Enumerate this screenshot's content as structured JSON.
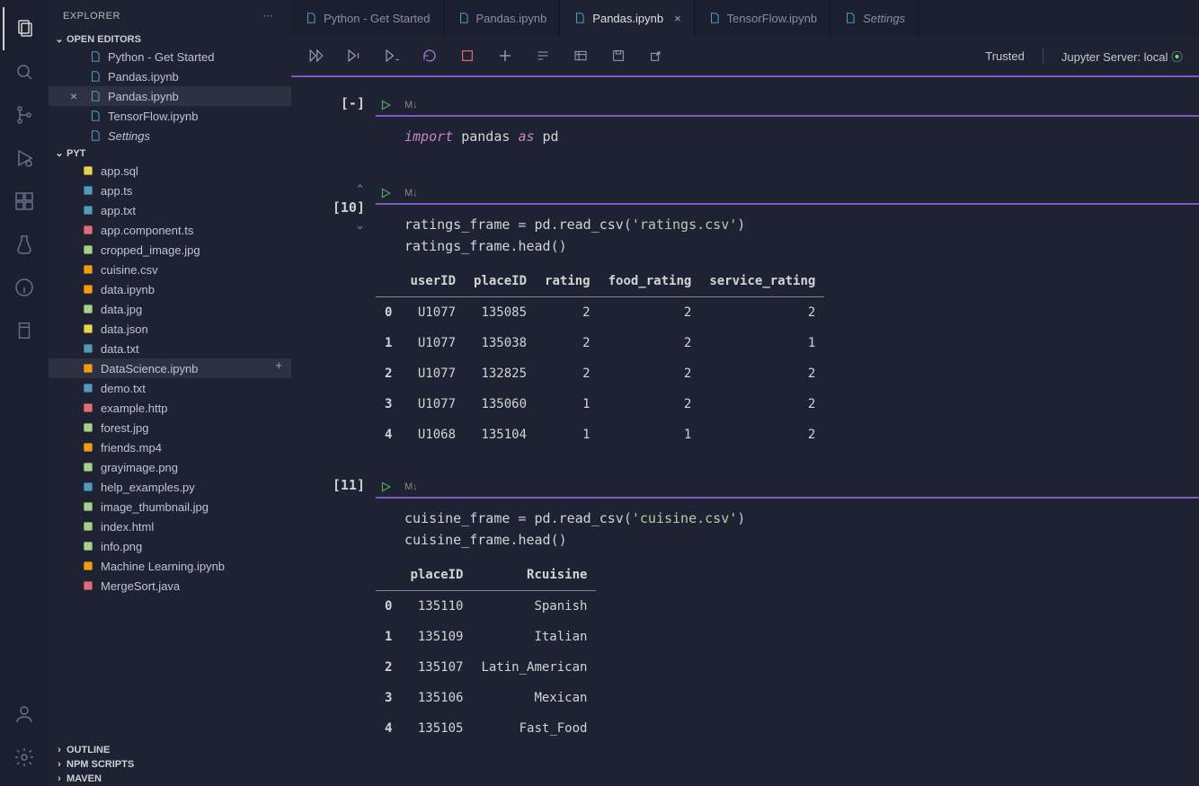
{
  "sidebar": {
    "title": "EXPLORER",
    "sections": {
      "open_editors": {
        "label": "OPEN EDITORS",
        "items": [
          {
            "name": "Python - Get Started",
            "icon": "file-blue"
          },
          {
            "name": "Pandas.ipynb",
            "icon": "file-blue"
          },
          {
            "name": "Pandas.ipynb",
            "icon": "file-blue",
            "active": true,
            "closable": true
          },
          {
            "name": "TensorFlow.ipynb",
            "icon": "file-blue"
          },
          {
            "name": "Settings",
            "icon": "file-blue",
            "italic": true
          }
        ]
      },
      "folder": {
        "label": "PYT",
        "items": [
          {
            "name": "app.sql",
            "color": "#e8d44d"
          },
          {
            "name": "app.ts",
            "color": "#519aba"
          },
          {
            "name": "app.txt",
            "color": "#519aba"
          },
          {
            "name": "app.component.ts",
            "color": "#e06c75"
          },
          {
            "name": "cropped_image.jpg",
            "color": "#a6d189"
          },
          {
            "name": "cuisine.csv",
            "color": "#f39c12"
          },
          {
            "name": "data.ipynb",
            "color": "#f39c12"
          },
          {
            "name": "data.jpg",
            "color": "#a6d189"
          },
          {
            "name": "data.json",
            "color": "#e8d44d"
          },
          {
            "name": "data.txt",
            "color": "#519aba"
          },
          {
            "name": "DataScience.ipynb",
            "color": "#f39c12",
            "active": true
          },
          {
            "name": "demo.txt",
            "color": "#519aba"
          },
          {
            "name": "example.http",
            "color": "#e06c75"
          },
          {
            "name": "forest.jpg",
            "color": "#a6d189"
          },
          {
            "name": "friends.mp4",
            "color": "#f39c12"
          },
          {
            "name": "grayimage.png",
            "color": "#a6d189"
          },
          {
            "name": "help_examples.py",
            "color": "#519aba"
          },
          {
            "name": "image_thumbnail.jpg",
            "color": "#a6d189"
          },
          {
            "name": "index.html",
            "color": "#a6d189"
          },
          {
            "name": "info.png",
            "color": "#a6d189"
          },
          {
            "name": "Machine Learning.ipynb",
            "color": "#f39c12"
          },
          {
            "name": "MergeSort.java",
            "color": "#e06c75"
          }
        ]
      },
      "outline": "OUTLINE",
      "npm": "NPM SCRIPTS",
      "maven": "MAVEN"
    }
  },
  "tabs": [
    {
      "label": "Python - Get Started"
    },
    {
      "label": "Pandas.ipynb"
    },
    {
      "label": "Pandas.ipynb",
      "active": true,
      "closable": true
    },
    {
      "label": "TensorFlow.ipynb"
    },
    {
      "label": "Settings",
      "italic": true
    }
  ],
  "toolbar": {
    "trusted": "Trusted",
    "server": "Jupyter Server: local"
  },
  "cells": [
    {
      "exec": "[-]",
      "md": "M↓",
      "code_html": "<span class='kw'>import</span> <span class='var'>pandas</span> <span class='kw'>as</span> <span class='var'>pd</span>"
    },
    {
      "exec": "[10]",
      "arrows": true,
      "md": "M↓",
      "code_html": "<span class='var'>ratings_frame</span> = <span class='var'>pd</span>.<span class='fn'>read_csv</span>(<span class='str'>'ratings.csv'</span>)\n<span class='var'>ratings_frame</span>.<span class='fn'>head</span>()",
      "table": {
        "headers": [
          "",
          "userID",
          "placeID",
          "rating",
          "food_rating",
          "service_rating"
        ],
        "rows": [
          [
            "0",
            "U1077",
            "135085",
            "2",
            "2",
            "2"
          ],
          [
            "1",
            "U1077",
            "135038",
            "2",
            "2",
            "1"
          ],
          [
            "2",
            "U1077",
            "132825",
            "2",
            "2",
            "2"
          ],
          [
            "3",
            "U1077",
            "135060",
            "1",
            "2",
            "2"
          ],
          [
            "4",
            "U1068",
            "135104",
            "1",
            "1",
            "2"
          ]
        ]
      }
    },
    {
      "exec": "[11]",
      "md": "M↓",
      "code_html": "<span class='var'>cuisine_frame</span> = <span class='var'>pd</span>.<span class='fn'>read_csv</span>(<span class='str'>'cuisine.csv'</span>)\n<span class='var'>cuisine_frame</span>.<span class='fn'>head</span>()",
      "table": {
        "headers": [
          "",
          "placeID",
          "Rcuisine"
        ],
        "rows": [
          [
            "0",
            "135110",
            "Spanish"
          ],
          [
            "1",
            "135109",
            "Italian"
          ],
          [
            "2",
            "135107",
            "Latin_American"
          ],
          [
            "3",
            "135106",
            "Mexican"
          ],
          [
            "4",
            "135105",
            "Fast_Food"
          ]
        ]
      }
    }
  ]
}
